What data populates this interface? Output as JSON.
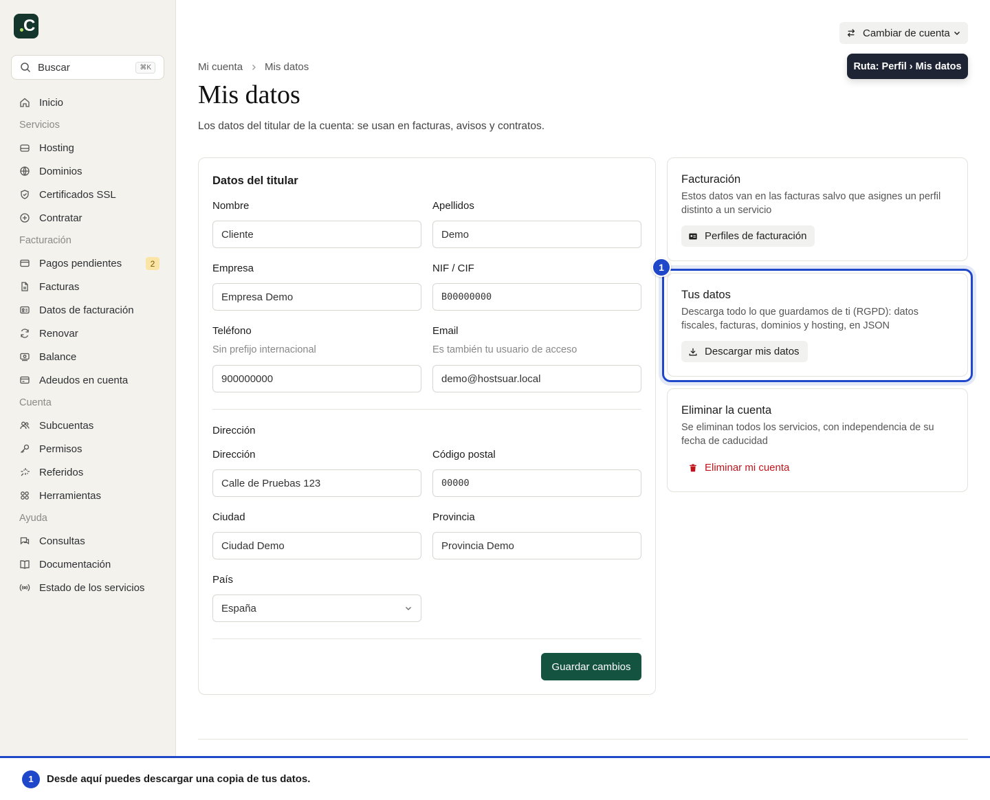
{
  "brand": {
    "logo_letter": "C",
    "accent": "#14362c",
    "dot": "#b7e36b"
  },
  "search": {
    "label": "Buscar",
    "shortcut": "⌘K"
  },
  "nav": {
    "inicio": "Inicio",
    "sec_servicios": "Servicios",
    "hosting": "Hosting",
    "dominios": "Dominios",
    "ssl": "Certificados SSL",
    "contratar": "Contratar",
    "sec_facturacion": "Facturación",
    "pagos": "Pagos pendientes",
    "pagos_badge": "2",
    "facturas": "Facturas",
    "datos_fact": "Datos de facturación",
    "renovar": "Renovar",
    "balance": "Balance",
    "adeudos": "Adeudos en cuenta",
    "sec_cuenta": "Cuenta",
    "subcuentas": "Subcuentas",
    "permisos": "Permisos",
    "referidos": "Referidos",
    "herramientas": "Herramientas",
    "sec_ayuda": "Ayuda",
    "consultas": "Consultas",
    "documentacion": "Documentación",
    "estado": "Estado de los servicios"
  },
  "topbar": {
    "switch_account": "Cambiar de cuenta",
    "tooltip": "Ruta: Perfil › Mis datos"
  },
  "header": {
    "crumb_root": "Mi cuenta",
    "crumb_current": "Mis datos",
    "title": "Mis datos",
    "subtitle": "Los datos del titular de la cuenta: se usan en facturas, avisos y contratos."
  },
  "form": {
    "title": "Datos del titular",
    "nombre_label": "Nombre",
    "nombre_value": "Cliente",
    "apellidos_label": "Apellidos",
    "apellidos_value": "Demo",
    "empresa_label": "Empresa",
    "empresa_value": "Empresa Demo",
    "nif_label": "NIF / CIF",
    "nif_value": "B00000000",
    "telefono_label": "Teléfono",
    "telefono_hint": "Sin prefijo internacional",
    "telefono_value": "900000000",
    "email_label": "Email",
    "email_hint": "Es también tu usuario de acceso",
    "email_value": "demo@hostsuar.local",
    "address_section": "Dirección",
    "direccion_label": "Dirección",
    "direccion_value": "Calle de Pruebas 123",
    "cp_label": "Código postal",
    "cp_value": "00000",
    "ciudad_label": "Ciudad",
    "ciudad_value": "Ciudad Demo",
    "provincia_label": "Provincia",
    "provincia_value": "Provincia Demo",
    "pais_label": "País",
    "pais_value": "España",
    "save": "Guardar cambios"
  },
  "billing_card": {
    "title": "Facturación",
    "desc": "Estos datos van en las facturas salvo que asignes un perfil distinto a un servicio",
    "button": "Perfiles de facturación"
  },
  "data_card": {
    "title": "Tus datos",
    "desc": "Descarga todo lo que guardamos de ti (RGPD): datos fiscales, facturas, dominios y hosting, en JSON",
    "button": "Descargar mis datos",
    "step": "1"
  },
  "delete_card": {
    "title": "Eliminar la cuenta",
    "desc": "Se eliminan todos los servicios, con independencia de su fecha de caducidad",
    "button": "Eliminar mi cuenta"
  },
  "tour": {
    "step": "1",
    "text": "Desde aquí puedes descargar una copia de tus datos."
  },
  "colors": {
    "primary_button": "#14533f",
    "highlight": "#1f47c9",
    "danger": "#c0141c"
  }
}
